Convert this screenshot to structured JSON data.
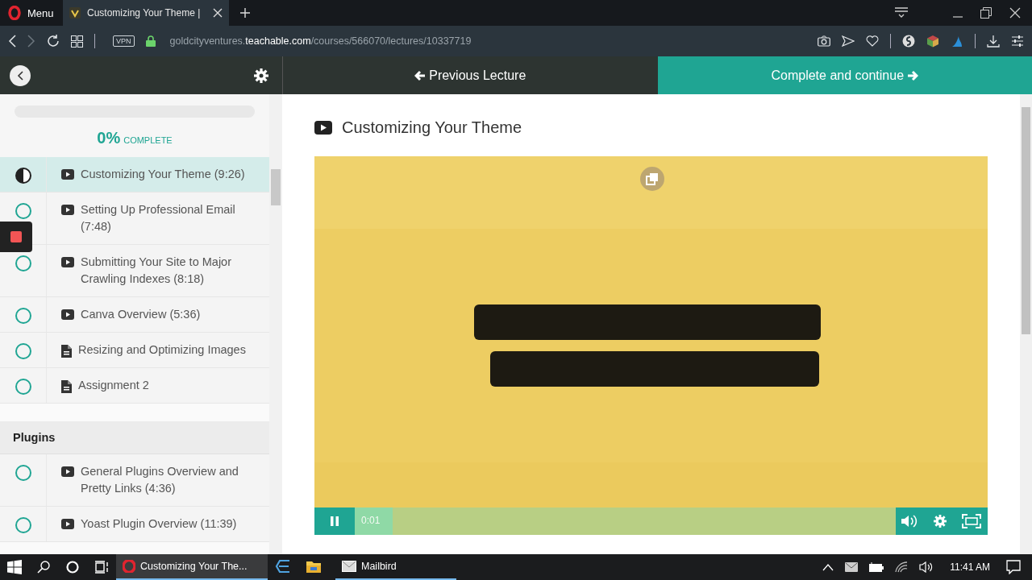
{
  "browser": {
    "menu_label": "Menu",
    "tab_title": "Customizing Your Theme |",
    "vpn_label": "VPN",
    "url": "goldcityventures.**teachable.com**/courses/566070/lectures/10337719"
  },
  "course_nav": {
    "previous_label": "Previous Lecture",
    "complete_label": "Complete and continue"
  },
  "progress": {
    "percent": "0%",
    "label": "COMPLETE",
    "level": 0
  },
  "sections": [
    {
      "lessons": [
        {
          "title": "Customizing Your Theme (9:26)",
          "kind": "video",
          "started": true,
          "selected": true
        },
        {
          "title": "Setting Up Professional Email (7:48)",
          "kind": "video",
          "started": false,
          "selected": false
        },
        {
          "title": "Submitting Your Site to Major Crawling Indexes (8:18)",
          "kind": "video",
          "started": false,
          "selected": false
        },
        {
          "title": "Canva Overview (5:36)",
          "kind": "video",
          "started": false,
          "selected": false
        },
        {
          "title": "Resizing and Optimizing Images",
          "kind": "document",
          "started": false,
          "selected": false
        },
        {
          "title": "Assignment 2",
          "kind": "document",
          "started": false,
          "selected": false
        }
      ]
    },
    {
      "title": "Plugins",
      "lessons": [
        {
          "title": "General Plugins Overview and Pretty Links (4:36)",
          "kind": "video",
          "started": false,
          "selected": false
        },
        {
          "title": "Yoast Plugin Overview (11:39)",
          "kind": "video",
          "started": false,
          "selected": false
        }
      ]
    }
  ],
  "lecture": {
    "title": "Customizing Your Theme",
    "player": {
      "kind": "picture",
      "playing": true,
      "time": "0:01",
      "level": 0.07
    }
  },
  "taskbar": {
    "apps": [
      {
        "kind": "opera",
        "label": "Customizing Your The...",
        "selected": true
      },
      {
        "kind": "e-app",
        "selected": false
      },
      {
        "kind": "folder",
        "selected": false
      },
      {
        "kind": "mail",
        "label": "Mailbird",
        "selected": false
      }
    ],
    "clock": "11:41 AM"
  }
}
